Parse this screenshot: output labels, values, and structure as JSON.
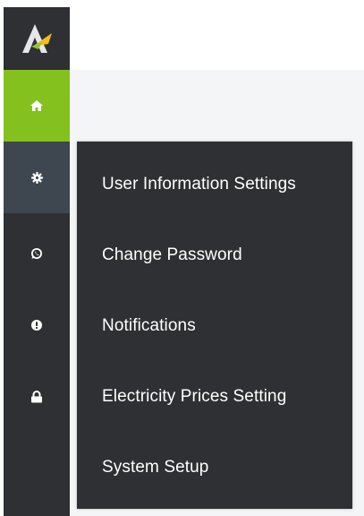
{
  "sidebar": {
    "logo_icon": "brand-logo-icon",
    "items": [
      {
        "icon": "home-icon",
        "active": true
      },
      {
        "icon": "gear-icon",
        "active": false,
        "highlight": true
      },
      {
        "icon": "whatsapp-icon",
        "active": false
      },
      {
        "icon": "alert-icon",
        "active": false
      },
      {
        "icon": "lock-icon",
        "active": false
      }
    ]
  },
  "settings_menu": {
    "items": [
      {
        "label": "User Information Settings"
      },
      {
        "label": "Change Password"
      },
      {
        "label": "Notifications"
      },
      {
        "label": "Electricity Prices Setting"
      },
      {
        "label": "System Setup"
      }
    ]
  },
  "colors": {
    "sidebar_bg": "#2e3033",
    "active_green": "#84c11f",
    "highlight_bg": "#3e4750",
    "menu_text": "#ffffff",
    "content_bg": "#f4f5f7"
  }
}
